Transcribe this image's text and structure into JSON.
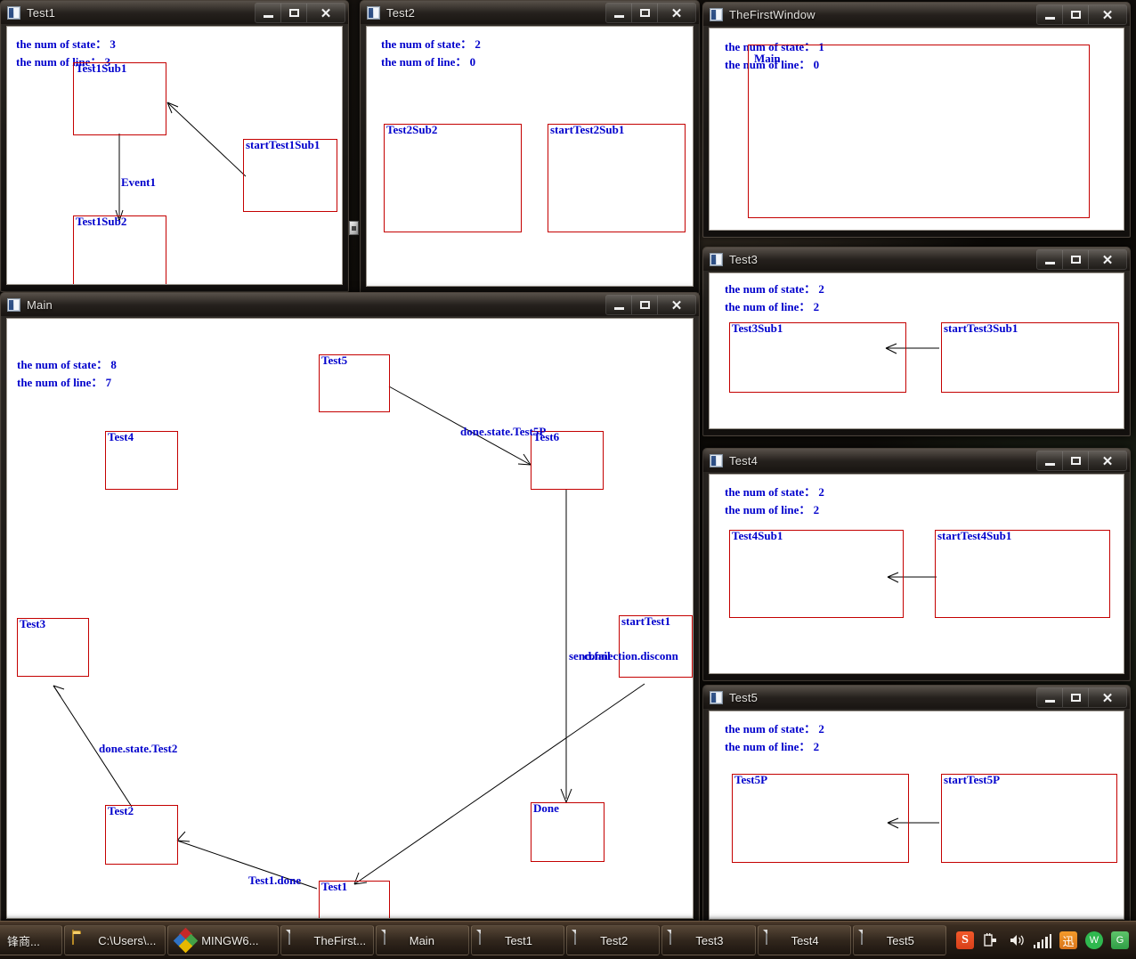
{
  "windows": {
    "test1": {
      "title": "Test1",
      "stats": {
        "states": "the num of state：  3",
        "lines": "the num of line：  3"
      },
      "nodes": [
        {
          "label": "Test1Sub1"
        },
        {
          "label": "Test1Sub2"
        },
        {
          "label": "startTest1Sub1"
        }
      ],
      "edge_labels": [
        "Event1"
      ]
    },
    "test2": {
      "title": "Test2",
      "stats": {
        "states": "the num of state：  2",
        "lines": "the num of line：  0"
      },
      "nodes": [
        {
          "label": "Test2Sub2"
        },
        {
          "label": "startTest2Sub1"
        }
      ],
      "edge_labels": []
    },
    "thefirstwindow": {
      "title": "TheFirstWindow",
      "stats": {
        "states": "the num of state：  1",
        "lines": "the num of line：  0"
      },
      "nodes": [
        {
          "label": "Main"
        }
      ],
      "edge_labels": []
    },
    "test3": {
      "title": "Test3",
      "stats": {
        "states": "the num of state：  2",
        "lines": "the num of line：  2"
      },
      "nodes": [
        {
          "label": "Test3Sub1"
        },
        {
          "label": "startTest3Sub1"
        }
      ],
      "edge_labels": []
    },
    "test4": {
      "title": "Test4",
      "stats": {
        "states": "the num of state：  2",
        "lines": "the num of line：  2"
      },
      "nodes": [
        {
          "label": "Test4Sub1"
        },
        {
          "label": "startTest4Sub1"
        }
      ],
      "edge_labels": []
    },
    "test5": {
      "title": "Test5",
      "stats": {
        "states": "the num of state：  2",
        "lines": "the num of line：  2"
      },
      "nodes": [
        {
          "label": "Test5P"
        },
        {
          "label": "startTest5P"
        }
      ],
      "edge_labels": []
    },
    "main": {
      "title": "Main",
      "stats": {
        "states": "the num of state：  8",
        "lines": "the num of line：  7"
      },
      "nodes": [
        {
          "label": "Test5"
        },
        {
          "label": "Test4"
        },
        {
          "label": "Test6"
        },
        {
          "label": "Test3"
        },
        {
          "label": "startTest1"
        },
        {
          "label": "Test2"
        },
        {
          "label": "Done"
        },
        {
          "label": "Test1"
        }
      ],
      "edge_labels": [
        "done.state.Test5P",
        "done.state.Test2",
        "Test1.done",
        "send.fail",
        "connection.disconn"
      ]
    }
  },
  "caption": {
    "minimize": "−",
    "maximize": "□",
    "close": "✕"
  },
  "taskbar": {
    "buttons": [
      {
        "label": "锋商...",
        "icon": "chinese-app-icon"
      },
      {
        "label": "C:\\Users\\...",
        "icon": "folder-icon"
      },
      {
        "label": "MINGW6...",
        "icon": "mingw-icon"
      },
      {
        "label": "TheFirst...",
        "icon": "document-icon"
      },
      {
        "label": "Main",
        "icon": "document-icon"
      },
      {
        "label": "Test1",
        "icon": "document-icon"
      },
      {
        "label": "Test2",
        "icon": "document-icon"
      },
      {
        "label": "Test3",
        "icon": "document-icon"
      },
      {
        "label": "Test4",
        "icon": "document-icon"
      },
      {
        "label": "Test5",
        "icon": "document-icon"
      }
    ],
    "tray": [
      {
        "name": "sogou-input-icon",
        "glyph": "S"
      },
      {
        "name": "power-plug-icon",
        "glyph": "🔌"
      },
      {
        "name": "volume-icon",
        "glyph": "🔊"
      },
      {
        "name": "network-signal-icon",
        "glyph": ""
      },
      {
        "name": "thunder-download-icon",
        "glyph": "迅"
      },
      {
        "name": "wechat-icon",
        "glyph": "W"
      },
      {
        "name": "green-app-icon",
        "glyph": "G"
      }
    ]
  },
  "colors": {
    "node_border": "#c40000",
    "node_text": "#0000cc",
    "window_client_bg": "#ffffff"
  }
}
